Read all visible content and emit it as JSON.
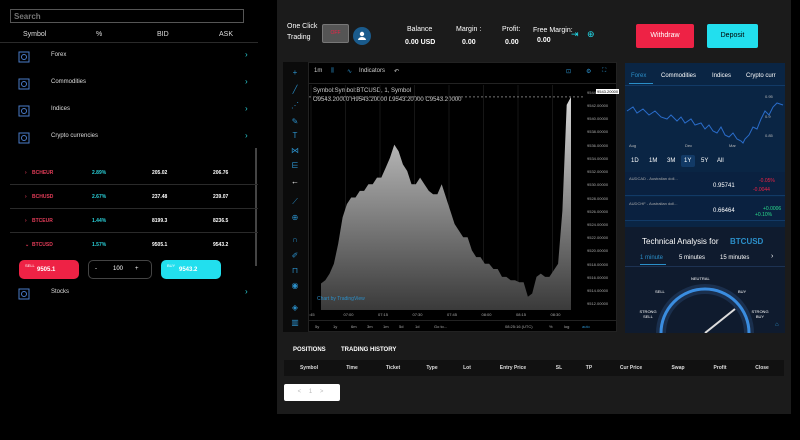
{
  "search": {
    "placeholder": "Search"
  },
  "market_header": {
    "symbol": "Symbol",
    "percent": "%",
    "bid": "BID",
    "ask": "ASK"
  },
  "categories": [
    {
      "label": "Forex"
    },
    {
      "label": "Commodities"
    },
    {
      "label": "Indices"
    },
    {
      "label": "Crypto currencies"
    },
    {
      "label": "Stocks"
    }
  ],
  "crypto_rows": [
    {
      "symbol": "BCHEUR",
      "pct": "2.89%",
      "bid": "205.02",
      "ask": "206.76"
    },
    {
      "symbol": "BCHUSD",
      "pct": "2.67%",
      "bid": "237.48",
      "ask": "239.07"
    },
    {
      "symbol": "BTCEUR",
      "pct": "1.44%",
      "bid": "8199.3",
      "ask": "8236.5"
    },
    {
      "symbol": "BTCUSD",
      "pct": "1.57%",
      "bid": "9505.1",
      "ask": "9543.2"
    }
  ],
  "trade": {
    "sell_small": "SELL",
    "sell_price": "9505.1",
    "buy_small": "BUY",
    "buy_price": "9543.2",
    "minus": "-",
    "qty": "100",
    "plus": "+"
  },
  "topbar": {
    "one_click": "One Click",
    "trading": "Trading",
    "toggle": "OFF",
    "balance_label": "Balance",
    "balance": "0.00 USD",
    "margin_label": "Margin :",
    "margin": "0.00",
    "profit_label": "Profit:",
    "profit": "0.00",
    "free_margin_label": "Free Margin:",
    "free_margin": "0.00",
    "withdraw": "Withdraw",
    "deposit": "Deposit"
  },
  "chart_toolbar": {
    "interval": "1m",
    "indicators": "Indicators"
  },
  "chart_header": {
    "symbol_line": "Symbol:Symbol:BTCUSD, 1, Symbol",
    "ohlc": "O9543.20000  H9543.20000  L9543.20000  C9543.20000"
  },
  "chart_data": {
    "type": "area",
    "x_labels": [
      ":45",
      "07:00",
      "07:15",
      "07:30",
      "07:45",
      "08:00",
      "08:15",
      "08:30"
    ],
    "y_ticks": [
      "9544.00000",
      "9542.00000",
      "9540.00000",
      "9538.00000",
      "9536.00000",
      "9534.00000",
      "9532.00000",
      "9530.00000",
      "9528.00000",
      "9526.00000",
      "9524.00000",
      "9522.00000",
      "9520.00000",
      "9518.00000",
      "9516.00000",
      "9514.00000",
      "9512.00000"
    ],
    "ylim": [
      9511,
      9545
    ],
    "values": [
      9515,
      9515.5,
      9516.5,
      9518,
      9521,
      9525,
      9527,
      9528,
      9528,
      9529,
      9529,
      9530,
      9530,
      9531,
      9531,
      9532.5,
      9534,
      9536,
      9535,
      9533,
      9532,
      9530,
      9530,
      9531,
      9530,
      9529,
      9528.5,
      9528.5,
      9530,
      9528,
      9526,
      9524,
      9523,
      9522,
      9522,
      9520,
      9519,
      9519,
      9518,
      9518,
      9517.2,
      9517.2,
      9516,
      9516,
      9515.5,
      9515.5,
      9515.2,
      9515.2,
      9513,
      9513.5,
      9516,
      9516.5,
      9516,
      9516,
      9517,
      9518,
      9526,
      9542,
      9543.2
    ],
    "current_price": "9543.20000",
    "watermark": "Chart by TradingView"
  },
  "chart_bottom": {
    "ranges": [
      "5y",
      "1y",
      "6m",
      "3m",
      "1m",
      "5d",
      "1d",
      "Go to..."
    ],
    "clock": "08:25:16 (UTC)",
    "pct": "%",
    "log": "log",
    "auto": "auto"
  },
  "market_tabs": [
    "Forex",
    "Commodities",
    "Indices",
    "Crypto curr"
  ],
  "mini_chart": {
    "labels": [
      "Aug",
      "Dec",
      "Mar"
    ],
    "ticks": [
      "0.95",
      "0.9",
      "0.85"
    ]
  },
  "timeframes": [
    "1D",
    "1M",
    "3M",
    "1Y",
    "5Y",
    "All"
  ],
  "quotes": [
    {
      "pair": "AUDCAD - Australian doll...",
      "price": "0.95741",
      "chg": "-0.05%",
      "chg2": "-0.0044"
    },
    {
      "pair": "AUDCHF - Australian doll...",
      "price": "0.66464",
      "chg": "+0.10%",
      "chg2": "+0.0006"
    }
  ],
  "analysis": {
    "title": "Technical Analysis for",
    "symbol": "BTCUSD",
    "tabs": [
      "1 minute",
      "5 minutes",
      "15 minutes"
    ],
    "labels": {
      "neutral": "NEUTRAL",
      "sell": "SELL",
      "buy": "BUY",
      "strong_sell": "STRONG SELL",
      "strong_buy": "STRONG BUY"
    }
  },
  "positions": {
    "tabs": [
      "POSITIONS",
      "TRADING HISTORY"
    ],
    "columns": [
      "Symbol",
      "Time",
      "Ticket",
      "Type",
      "Lot",
      "Entry Price",
      "SL",
      "TP",
      "Cur Price",
      "Swap",
      "Profit",
      "Close"
    ],
    "pager": "< 1 >"
  },
  "colors": {
    "sell": "#ee2245",
    "buy": "#22dfee",
    "accent": "#2b8fc9"
  }
}
